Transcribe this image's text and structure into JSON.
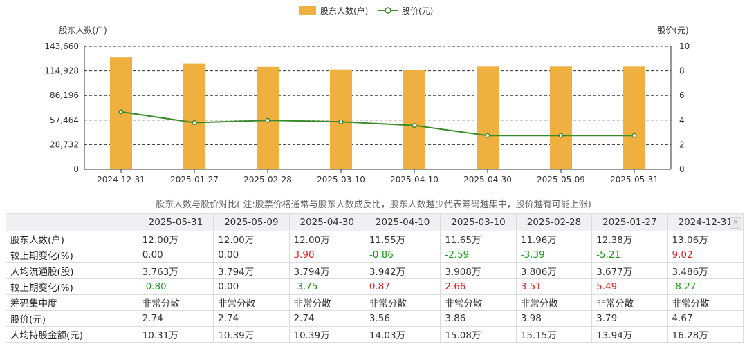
{
  "chart_data": {
    "type": "bar+line",
    "legend": {
      "position": "top-center",
      "items": [
        "股东人数(户)",
        "股价(元)"
      ]
    },
    "grid": "dashed-horizontal",
    "categories": [
      "2024-12-31",
      "2025-01-27",
      "2025-02-28",
      "2025-03-10",
      "2025-04-10",
      "2025-04-30",
      "2025-05-09",
      "2025-05-31"
    ],
    "series": [
      {
        "name": "股东人数(户)",
        "type": "bar",
        "axis": "left",
        "color": "#f0b040",
        "values": [
          130600,
          123800,
          119600,
          116500,
          115500,
          120000,
          120000,
          120000
        ]
      },
      {
        "name": "股价(元)",
        "type": "line",
        "axis": "right",
        "color": "#3a8a2a",
        "values": [
          4.67,
          3.79,
          3.98,
          3.86,
          3.56,
          2.74,
          2.74,
          2.74
        ]
      }
    ],
    "left_axis": {
      "label": "股东人数(户)",
      "ylim": [
        0,
        143660
      ],
      "ticks": [
        0,
        28732,
        57464,
        86196,
        114928,
        143660
      ],
      "tick_labels": [
        "0",
        "28,732",
        "57,464",
        "86,196",
        "114,928",
        "143,660"
      ]
    },
    "right_axis": {
      "label": "股价(元)",
      "ylim": [
        0,
        10
      ],
      "ticks": [
        0,
        2,
        4,
        6,
        8,
        10
      ],
      "tick_labels": [
        "0",
        "2",
        "4",
        "6",
        "8",
        "10"
      ]
    }
  },
  "caption": "股东人数与股价对比( 注:股票价格通常与股东人数成反比，股东人数越少代表筹码越集中，股价越有可能上涨)",
  "table": {
    "columns": [
      "2025-05-31",
      "2025-05-09",
      "2025-04-30",
      "2025-04-10",
      "2025-03-10",
      "2025-02-28",
      "2025-01-27",
      "2024-12-31"
    ],
    "rows": [
      {
        "label": "股东人数(户)",
        "cells": [
          {
            "v": "12.00万"
          },
          {
            "v": "12.00万"
          },
          {
            "v": "12.00万"
          },
          {
            "v": "11.55万"
          },
          {
            "v": "11.65万"
          },
          {
            "v": "11.96万"
          },
          {
            "v": "12.38万"
          },
          {
            "v": "13.06万"
          }
        ]
      },
      {
        "label": "较上期变化(%)",
        "cells": [
          {
            "v": "0.00"
          },
          {
            "v": "0.00"
          },
          {
            "v": "3.90",
            "c": "red"
          },
          {
            "v": "-0.86",
            "c": "green"
          },
          {
            "v": "-2.59",
            "c": "green"
          },
          {
            "v": "-3.39",
            "c": "green"
          },
          {
            "v": "-5.21",
            "c": "green"
          },
          {
            "v": "9.02",
            "c": "red"
          }
        ]
      },
      {
        "label": "人均流通股(股)",
        "cells": [
          {
            "v": "3.763万"
          },
          {
            "v": "3.794万"
          },
          {
            "v": "3.794万"
          },
          {
            "v": "3.942万"
          },
          {
            "v": "3.908万"
          },
          {
            "v": "3.806万"
          },
          {
            "v": "3.677万"
          },
          {
            "v": "3.486万"
          }
        ]
      },
      {
        "label": "较上期变化(%)",
        "cells": [
          {
            "v": "-0.80",
            "c": "green"
          },
          {
            "v": "0.00"
          },
          {
            "v": "-3.75",
            "c": "green"
          },
          {
            "v": "0.87",
            "c": "red"
          },
          {
            "v": "2.66",
            "c": "red"
          },
          {
            "v": "3.51",
            "c": "red"
          },
          {
            "v": "5.49",
            "c": "red"
          },
          {
            "v": "-8.27",
            "c": "green"
          }
        ]
      },
      {
        "label": "筹码集中度",
        "cells": [
          {
            "v": "非常分散"
          },
          {
            "v": "非常分散"
          },
          {
            "v": "非常分散"
          },
          {
            "v": "非常分散"
          },
          {
            "v": "非常分散"
          },
          {
            "v": "非常分散"
          },
          {
            "v": "非常分散"
          },
          {
            "v": "非常分散"
          }
        ]
      },
      {
        "label": "股价(元)",
        "cells": [
          {
            "v": "2.74"
          },
          {
            "v": "2.74"
          },
          {
            "v": "2.74"
          },
          {
            "v": "3.56"
          },
          {
            "v": "3.86"
          },
          {
            "v": "3.98"
          },
          {
            "v": "3.79"
          },
          {
            "v": "4.67"
          }
        ]
      },
      {
        "label": "人均持股金额(元)",
        "cells": [
          {
            "v": "10.31万"
          },
          {
            "v": "10.39万"
          },
          {
            "v": "10.39万"
          },
          {
            "v": "14.03万"
          },
          {
            "v": "15.08万"
          },
          {
            "v": "15.15万"
          },
          {
            "v": "13.94万"
          },
          {
            "v": "16.28万"
          }
        ]
      }
    ]
  }
}
